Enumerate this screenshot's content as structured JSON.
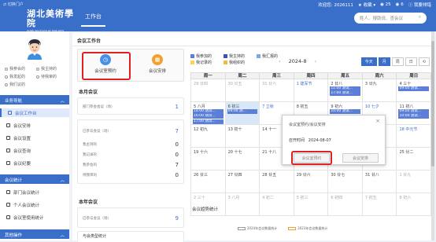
{
  "header": {
    "portal_switch": "切换门户",
    "school_name_cn": "湖北美術學院",
    "school_name_en": "HUBEI INSTITUTE OF FINE ARTS",
    "active_tab": "工作台",
    "welcome": "欢迎您: 2026111",
    "favorites": "收藏",
    "count_a": "25",
    "count_b": "6",
    "feedback": "我要排错",
    "search_placeholder": "姓人、搜助说、查会议"
  },
  "sidebar": {
    "user_links": [
      "我参会的",
      "我主持的",
      "我发起的",
      "待我审的",
      "我们议的"
    ],
    "sections": [
      {
        "title": "业务导航",
        "items": [
          "会议工作台",
          "会议安排",
          "会议设置",
          "会议查询",
          "会议纪要"
        ]
      },
      {
        "title": "会议统计",
        "items": [
          "部门会议统计",
          "个人会议统计",
          "会议室使用统计"
        ]
      },
      {
        "title": "其他操作",
        "items": []
      }
    ],
    "active_item": "会议工作台"
  },
  "page": {
    "title": "会议工作台",
    "actions": [
      {
        "label": "会议室预约",
        "icon": "clock-icon",
        "color": "#4a8fe7"
      },
      {
        "label": "会议安排",
        "icon": "calendar-icon",
        "color": "#f0a030"
      }
    ],
    "month_meetings": {
      "title": "本月会议",
      "rows": [
        {
          "label": "部门参会会议（场）",
          "value": "1"
        }
      ]
    },
    "stats_group": {
      "rows": [
        {
          "label": "已参与会议（场）",
          "value": "7"
        },
        {
          "label": "我主持的",
          "value": "0"
        },
        {
          "label": "我记录的",
          "value": "0"
        },
        {
          "label": "我参会的",
          "value": "7"
        },
        {
          "label": "待我审的",
          "value": "0"
        }
      ]
    },
    "year_meetings": {
      "title": "本年会议",
      "rows": [
        {
          "label": "已参与会议（场）",
          "value": "9"
        }
      ]
    },
    "type_stats_title": "与会类型统计",
    "trend_title": "会议趋势统计",
    "trend_legend": [
      "2024年会议数量统计",
      "2023年会议数量统计"
    ]
  },
  "calendar": {
    "legend": [
      {
        "label": "我参加的",
        "color": "#5b7fd8"
      },
      {
        "label": "我主持的",
        "color": "#3f51b5"
      },
      {
        "label": "我汇报的",
        "color": "#7aa7e8"
      },
      {
        "label": "我记录的",
        "color": "#ffd34d"
      },
      {
        "label": "我组织的",
        "color": "#f5b942"
      }
    ],
    "month_label": "2024-8",
    "prev": "‹",
    "next": "›",
    "view_buttons": [
      "今天",
      "月",
      "周",
      "日",
      "⟲"
    ],
    "weekdays": [
      "周一",
      "周二",
      "周三",
      "周四",
      "周五",
      "周六",
      "周日"
    ],
    "weeks": [
      [
        {
          "d": "29",
          "l": "廿四",
          "m": true
        },
        {
          "d": "30",
          "l": "廿五",
          "m": true
        },
        {
          "d": "31",
          "l": "廿六",
          "m": true
        },
        {
          "d": "1",
          "l": "建军节",
          "h": true
        },
        {
          "d": "2",
          "l": "廿八"
        },
        {
          "d": "3",
          "l": "廿九"
        },
        {
          "d": "4",
          "l": "三十"
        }
      ],
      [
        {
          "d": "5",
          "l": "八月"
        },
        {
          "d": "6",
          "l": "初三"
        },
        {
          "d": "7",
          "l": "立秋",
          "h": true
        },
        {
          "d": "8",
          "l": "初五"
        },
        {
          "d": "9",
          "l": "初六"
        },
        {
          "d": "10",
          "l": "七夕",
          "h": true
        },
        {
          "d": "11",
          "l": "初八"
        }
      ],
      [
        {
          "d": "12",
          "l": "初九"
        },
        {
          "d": "13",
          "l": "初十"
        },
        {
          "d": "14",
          "l": "十一"
        },
        {
          "d": "15",
          "l": "十二"
        },
        {
          "d": "16",
          "l": "十三"
        },
        {
          "d": "17",
          "l": "十四"
        },
        {
          "d": "18",
          "l": "中元节",
          "h": true
        }
      ],
      [
        {
          "d": "19",
          "l": "十六"
        },
        {
          "d": "20",
          "l": "十七"
        },
        {
          "d": "21",
          "l": "十八"
        },
        {
          "d": "22",
          "l": "十九"
        },
        {
          "d": "23",
          "l": "处暑",
          "h": true
        },
        {
          "d": "24",
          "l": "廿一"
        },
        {
          "d": "25",
          "l": "廿二"
        }
      ],
      [
        {
          "d": "26",
          "l": "廿三"
        },
        {
          "d": "27",
          "l": "廿四"
        },
        {
          "d": "28",
          "l": "廿五"
        },
        {
          "d": "29",
          "l": "廿六"
        },
        {
          "d": "30",
          "l": "廿七"
        },
        {
          "d": "31",
          "l": "廿八"
        },
        {
          "d": "1",
          "l": "廿九",
          "m": true
        }
      ],
      [
        {
          "d": "2",
          "l": "三十",
          "m": true
        },
        {
          "d": "3",
          "l": "八月",
          "m": true
        },
        {
          "d": "4",
          "l": "初二",
          "m": true
        },
        {
          "d": "5",
          "l": "初三",
          "m": true
        },
        {
          "d": "6",
          "l": "初四",
          "m": true
        },
        {
          "d": "7",
          "l": "初五",
          "m": true
        },
        {
          "d": "8",
          "l": "初六",
          "m": true
        }
      ]
    ],
    "events": [
      {
        "week": 0,
        "day": 4,
        "row": 1,
        "text": "11:00 测试...",
        "color": "#5b7fd8"
      },
      {
        "week": 0,
        "day": 4,
        "row": 2,
        "text": "17:00 测试...",
        "color": "#5b7fd8"
      },
      {
        "week": 0,
        "day": 6,
        "row": 1,
        "text": "09:00 测试...",
        "color": "#5b7fd8"
      },
      {
        "week": 1,
        "day": 0,
        "row": 1,
        "text": "14:00 测试...",
        "color": "#5b7fd8"
      },
      {
        "week": 1,
        "day": 0,
        "row": 2,
        "text": "16:00 测试...",
        "color": "#5b7fd8"
      },
      {
        "week": 1,
        "day": 0,
        "row": 3,
        "text": "17:00 测试...",
        "color": "#5b7fd8"
      },
      {
        "week": 1,
        "day": 1,
        "row": 1,
        "text": "09:00 测...",
        "color": "#5b7fd8"
      },
      {
        "week": 1,
        "day": 4,
        "row": 1,
        "text": "10:00 测试...",
        "color": "#5b7fd8"
      },
      {
        "week": 1,
        "day": 6,
        "row": 1,
        "text": "09:00 测试...",
        "color": "#5b7fd8"
      },
      {
        "week": 1,
        "day": 6,
        "row": 2,
        "text": "10:00 测试...",
        "color": "#5b7fd8"
      }
    ],
    "today": {
      "week": 1,
      "day": 1
    }
  },
  "dialog": {
    "title": "会议室预约/会议安排",
    "date_label": "召开时间",
    "date_value": "2024-08-07",
    "btn_reserve": "会议室预约",
    "btn_arrange": "会议安排"
  }
}
